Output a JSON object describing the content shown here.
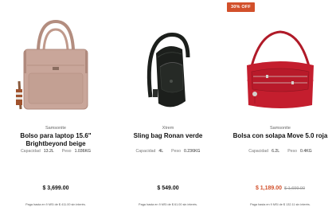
{
  "products": [
    {
      "brand": "Samsonite",
      "name": "Bolso para laptop 15.6\" Brightbeyond beige",
      "capacity_label": "Capacidad",
      "capacity": "13.2L",
      "weight_label": "Peso",
      "weight": "1.036KG",
      "price": "$ 3,699.00",
      "installments": "Paga hasta en 9 MSI de $ 411.00 sin interés.",
      "image_icon": "beige-laptop-bag"
    },
    {
      "brand": "Xtrem",
      "name": "Sling bag Ronan verde",
      "capacity_label": "Capacidad",
      "capacity": "4L",
      "weight_label": "Peso",
      "weight": "0.236KG",
      "price": "$ 549.00",
      "installments": "Paga hasta en 9 MSI de $ 61.00 sin interés.",
      "image_icon": "black-sling-bag"
    },
    {
      "badge": "30% OFF",
      "brand": "Samsonite",
      "name": "Bolsa con solapa Move 5.0 roja",
      "capacity_label": "Capacidad",
      "capacity": "6.2L",
      "weight_label": "Peso",
      "weight": "0.4KG",
      "price": "$ 1,189.00",
      "old_price": "$ 1,699.00",
      "installments": "Paga hasta en 9 MSI de $ 132.11 sin interés.",
      "image_icon": "red-crossbody-bag"
    }
  ],
  "colors": {
    "sale_accent": "#d2502b",
    "beige": "#c9a69a",
    "black_bag": "#1c1f1c",
    "red_bag": "#c41e2e"
  }
}
